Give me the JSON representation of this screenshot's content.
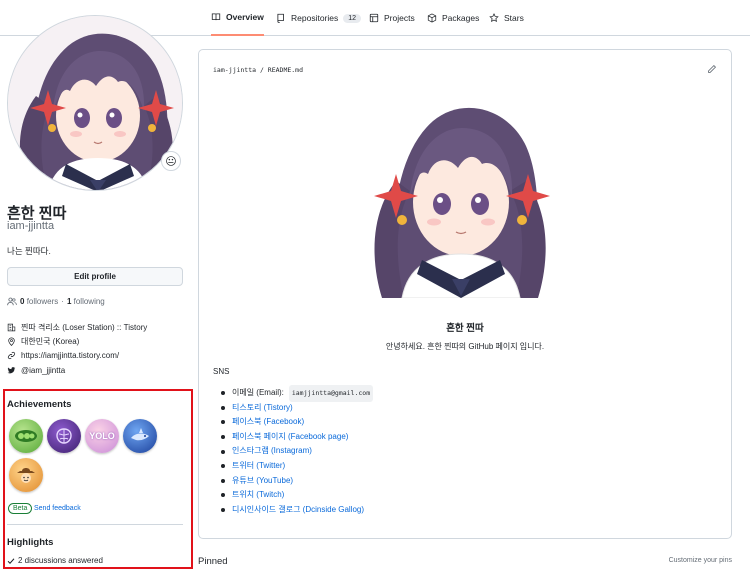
{
  "nav": {
    "tabs": [
      {
        "label": "Overview",
        "icon": "book-icon",
        "active": true
      },
      {
        "label": "Repositories",
        "icon": "repo-icon",
        "count": "12"
      },
      {
        "label": "Projects",
        "icon": "table-icon"
      },
      {
        "label": "Packages",
        "icon": "package-icon"
      },
      {
        "label": "Stars",
        "icon": "star-icon"
      }
    ]
  },
  "profile": {
    "status_emoji": "😐",
    "fullname": "흔한 찐따",
    "username": "iam-jjintta",
    "bio": "나는 찐따다.",
    "edit_label": "Edit profile",
    "followers_count": "0",
    "followers_label": "followers",
    "separator": "·",
    "following_count": "1",
    "following_label": "following",
    "org": "찐따 격리소 (Loser Station) :: Tistory",
    "location": "대한민국 (Korea)",
    "website": "https://iamjjintta.tistory.com/",
    "twitter": "@iam_jjintta"
  },
  "achievements": {
    "title": "Achievements",
    "badges": [
      {
        "name": "pair-extraordinaire",
        "color": "#7fc75a"
      },
      {
        "name": "galaxy-brain",
        "color": "#6b3fa0"
      },
      {
        "name": "yolo",
        "color": "#f2a6c4",
        "text": "YOLO"
      },
      {
        "name": "pull-shark",
        "color": "#2f6fd8"
      },
      {
        "name": "quickdraw",
        "color": "#f2b544"
      }
    ],
    "beta_label": "Beta",
    "feedback_label": "Send feedback"
  },
  "highlights": {
    "title": "Highlights",
    "item": "2 discussions answered"
  },
  "readme": {
    "path": "iam-jjintta / README.md",
    "title": "흔한 찐따",
    "subtitle": "안녕하세요. 흔한 찐따의 GitHub 페이지 입니다.",
    "sns_title": "SNS",
    "links": [
      {
        "label": "이메일 (Email):",
        "code": "iamjjintta@gmail.com"
      },
      {
        "label": "티스토리 (Tistory)"
      },
      {
        "label": "페이스북 (Facebook)"
      },
      {
        "label": "페이스북 페이지 (Facebook page)"
      },
      {
        "label": "인스타그램 (Instagram)"
      },
      {
        "label": "트위터 (Twitter)"
      },
      {
        "label": "유튜브 (YouTube)"
      },
      {
        "label": "트위치 (Twitch)"
      },
      {
        "label": "디시인사이드 갤로그 (Dcinside Gallog)"
      }
    ]
  },
  "pinned": {
    "title": "Pinned",
    "customize_label": "Customize your pins"
  }
}
